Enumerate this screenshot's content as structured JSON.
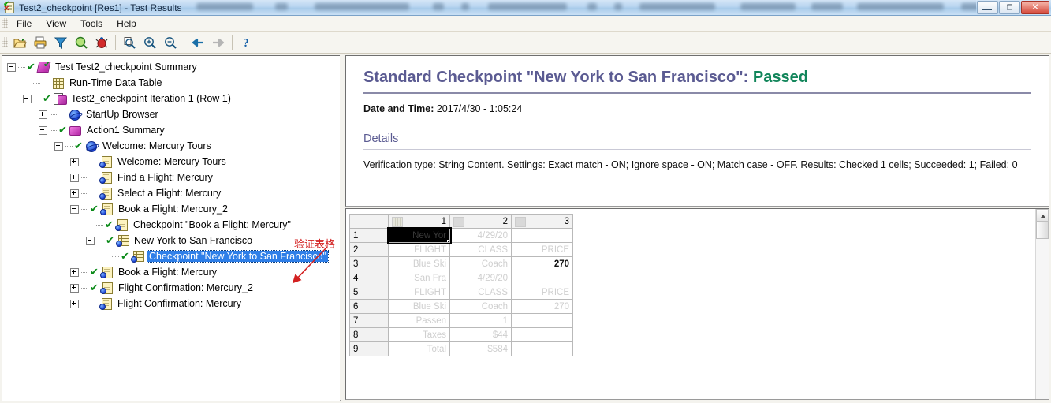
{
  "window": {
    "title": "Test2_checkpoint [Res1] - Test Results",
    "icon": "test-results-icon",
    "minimize_label": "",
    "restore_label": "❐",
    "close_label": "✕"
  },
  "menu": {
    "items": [
      {
        "label": "File",
        "name": "menu-file"
      },
      {
        "label": "View",
        "name": "menu-view"
      },
      {
        "label": "Tools",
        "name": "menu-tools"
      },
      {
        "label": "Help",
        "name": "menu-help"
      }
    ]
  },
  "toolbar": {
    "buttons": [
      {
        "name": "open-icon",
        "title": "Open"
      },
      {
        "name": "print-icon",
        "title": "Print"
      },
      {
        "name": "filter-icon",
        "title": "Filter"
      },
      {
        "name": "search-icon",
        "title": "Find"
      },
      {
        "name": "add-defect-icon",
        "title": "Add Defect"
      },
      {
        "name": "zoom-page-icon",
        "title": "Zoom Page"
      },
      {
        "name": "zoom-in-icon",
        "title": "Zoom In"
      },
      {
        "name": "zoom-out-icon",
        "title": "Zoom Out"
      },
      {
        "name": "back-arrow-icon",
        "title": "Back"
      },
      {
        "name": "forward-arrow-icon",
        "title": "Forward"
      },
      {
        "name": "help-icon",
        "title": "Help"
      }
    ]
  },
  "tree": {
    "annotation": "验证表格",
    "nodes": [
      {
        "label": "Test Test2_checkpoint Summary",
        "indent": 0,
        "toggle": "minus",
        "check": true,
        "icon": "test-icon"
      },
      {
        "label": "Run-Time Data Table",
        "indent": 1,
        "toggle": "none",
        "check": false,
        "icon": "data-table-icon"
      },
      {
        "label": "Test2_checkpoint Iteration 1 (Row 1)",
        "indent": 1,
        "toggle": "minus",
        "check": true,
        "icon": "iteration-icon"
      },
      {
        "label": "StartUp Browser",
        "indent": 2,
        "toggle": "plus",
        "check": false,
        "icon": "browser-icon"
      },
      {
        "label": "Action1 Summary",
        "indent": 2,
        "toggle": "minus",
        "check": true,
        "icon": "action-icon"
      },
      {
        "label": "Welcome: Mercury Tours",
        "indent": 3,
        "toggle": "minus",
        "check": true,
        "icon": "browser-icon"
      },
      {
        "label": "Welcome: Mercury Tours",
        "indent": 4,
        "toggle": "plus",
        "check": false,
        "icon": "page-icon"
      },
      {
        "label": "Find a Flight: Mercury",
        "indent": 4,
        "toggle": "plus",
        "check": false,
        "icon": "page-icon"
      },
      {
        "label": "Select a Flight: Mercury",
        "indent": 4,
        "toggle": "plus",
        "check": false,
        "icon": "page-icon"
      },
      {
        "label": "Book a Flight: Mercury_2",
        "indent": 4,
        "toggle": "minus",
        "check": true,
        "icon": "page-icon"
      },
      {
        "label": "Checkpoint \"Book a Flight: Mercury\"",
        "indent": 5,
        "toggle": "none",
        "check": true,
        "icon": "page-icon"
      },
      {
        "label": "New York to San Francisco",
        "indent": 5,
        "toggle": "minus",
        "check": true,
        "icon": "table-icon"
      },
      {
        "label": "Checkpoint \"New York to San Francisco\"",
        "indent": 6,
        "toggle": "none",
        "check": true,
        "icon": "table-icon",
        "selected": true
      },
      {
        "label": "Book a Flight: Mercury",
        "indent": 4,
        "toggle": "plus",
        "check": true,
        "icon": "page-icon"
      },
      {
        "label": "Flight Confirmation: Mercury_2",
        "indent": 4,
        "toggle": "plus",
        "check": true,
        "icon": "page-icon"
      },
      {
        "label": "Flight Confirmation: Mercury",
        "indent": 4,
        "toggle": "plus",
        "check": false,
        "icon": "page-icon"
      }
    ]
  },
  "details": {
    "title_main": "Standard Checkpoint \"New York to San Francisco\": ",
    "title_status": "Passed",
    "datetime_label": "Date and Time: ",
    "datetime_value": "2017/4/30 - 1:05:24",
    "section_heading": "Details",
    "verification_text": "Verification type: String Content. Settings: Exact match - ON; Ignore space - ON; Match case - OFF. Results: Checked 1 cells; Succeeded: 1; Failed: 0"
  },
  "table": {
    "column_headers": [
      "1",
      "2",
      "3"
    ],
    "row_headers": [
      "1",
      "2",
      "3",
      "4",
      "5",
      "6",
      "7",
      "8",
      "9"
    ],
    "rows": [
      [
        {
          "v": "New Yor",
          "style": "selected"
        },
        {
          "v": "4/29/20",
          "style": "faded"
        },
        {
          "v": "",
          "style": "faded"
        }
      ],
      [
        {
          "v": "FLIGHT",
          "style": "faded"
        },
        {
          "v": "CLASS",
          "style": "faded"
        },
        {
          "v": "PRICE",
          "style": "faded"
        }
      ],
      [
        {
          "v": "Blue Ski",
          "style": "faded"
        },
        {
          "v": "Coach",
          "style": "faded"
        },
        {
          "v": "270",
          "style": "dark"
        }
      ],
      [
        {
          "v": "San Fra",
          "style": "faded"
        },
        {
          "v": "4/29/20",
          "style": "faded"
        },
        {
          "v": "",
          "style": "faded"
        }
      ],
      [
        {
          "v": "FLIGHT",
          "style": "faded"
        },
        {
          "v": "CLASS",
          "style": "faded"
        },
        {
          "v": "PRICE",
          "style": "faded"
        }
      ],
      [
        {
          "v": "Blue Ski",
          "style": "faded"
        },
        {
          "v": "Coach",
          "style": "faded"
        },
        {
          "v": "270",
          "style": "faded"
        }
      ],
      [
        {
          "v": "Passen",
          "style": "faded"
        },
        {
          "v": "1",
          "style": "faded"
        },
        {
          "v": "",
          "style": "faded"
        }
      ],
      [
        {
          "v": "Taxes",
          "style": "faded"
        },
        {
          "v": "$44",
          "style": "faded"
        },
        {
          "v": "",
          "style": "faded"
        }
      ],
      [
        {
          "v": "Total",
          "style": "faded"
        },
        {
          "v": "$584",
          "style": "faded"
        },
        {
          "v": "",
          "style": "faded"
        }
      ]
    ]
  },
  "colors": {
    "title_purple": "#5b5b92",
    "pass_green": "#11855a",
    "selection_blue": "#2f7fe8",
    "annotation_red": "#d32020"
  }
}
